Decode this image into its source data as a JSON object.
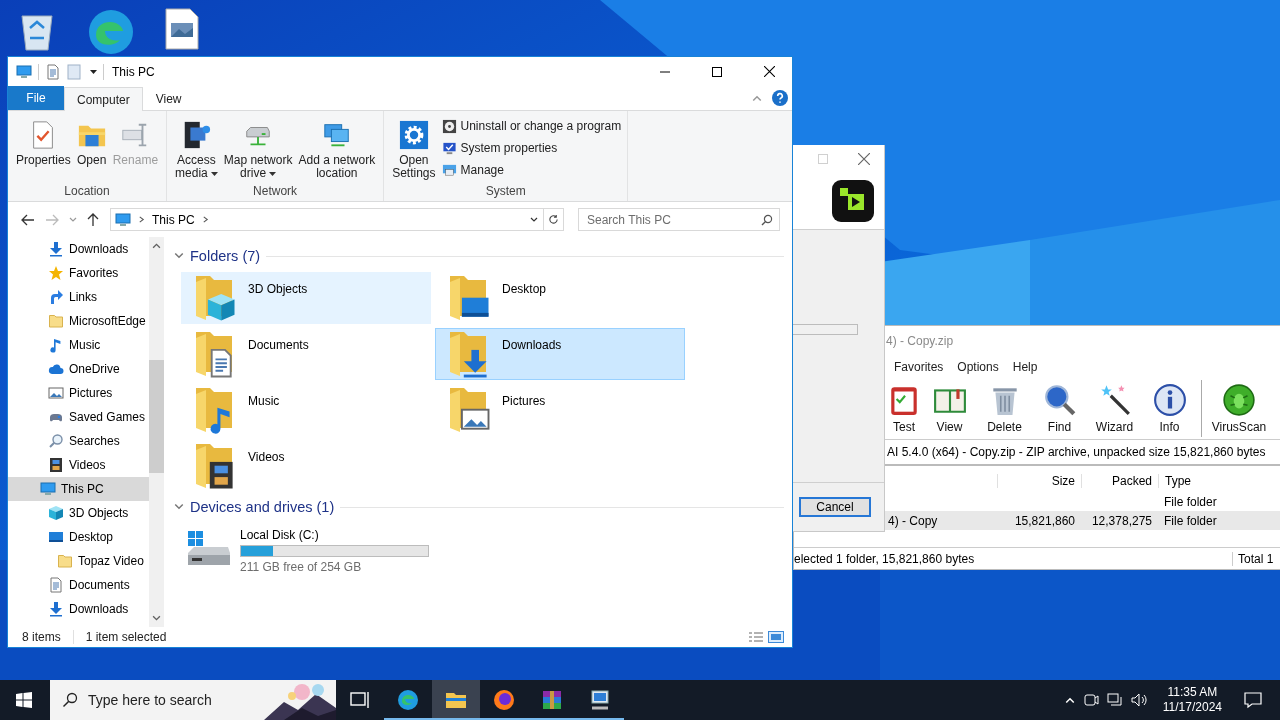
{
  "explorer": {
    "title": "This PC",
    "tabs": [
      {
        "label": "File",
        "kind": "menu",
        "selected": false
      },
      {
        "label": "Computer",
        "kind": "tab",
        "selected": true
      },
      {
        "label": "View",
        "kind": "tab",
        "selected": false
      }
    ],
    "ribbon": [
      {
        "label": "Location",
        "buttons": [
          {
            "label": "Properties",
            "kind": "properties",
            "disabled": false,
            "dropdown": false
          },
          {
            "label": "Open",
            "kind": "open",
            "disabled": false,
            "dropdown": false
          },
          {
            "label": "Rename",
            "kind": "rename",
            "disabled": true,
            "dropdown": false
          }
        ]
      },
      {
        "label": "Network",
        "buttons": [
          {
            "label": "Access\nmedia",
            "kind": "media",
            "disabled": false,
            "dropdown": true
          },
          {
            "label": "Map network\ndrive",
            "kind": "drive",
            "disabled": false,
            "dropdown": true
          },
          {
            "label": "Add a network\nlocation",
            "kind": "netloc",
            "disabled": false,
            "dropdown": false
          }
        ]
      },
      {
        "label": "System",
        "buttons": [
          {
            "label": "Open\nSettings",
            "kind": "settings",
            "disabled": false,
            "dropdown": false
          }
        ],
        "links": [
          {
            "label": "Uninstall or change a program",
            "kind": "uninstall"
          },
          {
            "label": "System properties",
            "kind": "system"
          },
          {
            "label": "Manage",
            "kind": "manage"
          }
        ]
      }
    ],
    "address": {
      "path": [
        "This PC"
      ],
      "search_placeholder": "Search This PC"
    },
    "nav": [
      {
        "label": "Downloads",
        "kind": "download",
        "selected": false
      },
      {
        "label": "Favorites",
        "kind": "star",
        "selected": false
      },
      {
        "label": "Links",
        "kind": "link",
        "selected": false
      },
      {
        "label": "MicrosoftEdge",
        "kind": "folder",
        "selected": false
      },
      {
        "label": "Music",
        "kind": "music",
        "selected": false
      },
      {
        "label": "OneDrive",
        "kind": "cloud",
        "selected": false
      },
      {
        "label": "Pictures",
        "kind": "picture",
        "selected": false
      },
      {
        "label": "Saved Games",
        "kind": "game",
        "selected": false
      },
      {
        "label": "Searches",
        "kind": "search",
        "selected": false
      },
      {
        "label": "Videos",
        "kind": "video",
        "selected": false
      },
      {
        "label": "This PC",
        "kind": "pc",
        "selected": true,
        "children": [
          {
            "label": "3D Objects",
            "kind": "cube",
            "selected": false
          },
          {
            "label": "Desktop",
            "kind": "desktop",
            "selected": false,
            "children": [
              {
                "label": "Topaz Video",
                "kind": "folder",
                "selected": false
              }
            ]
          },
          {
            "label": "Documents",
            "kind": "document",
            "selected": false
          },
          {
            "label": "Downloads",
            "kind": "download",
            "selected": false
          }
        ]
      }
    ],
    "sections": [
      {
        "title": "Folders (7)",
        "kind": "folders",
        "items": [
          {
            "name": "3D Objects",
            "kind": "cube",
            "selected": false,
            "hot": true
          },
          {
            "name": "Desktop",
            "kind": "desktop",
            "selected": false,
            "hot": false
          },
          {
            "name": "Documents",
            "kind": "document",
            "selected": false,
            "hot": false
          },
          {
            "name": "Downloads",
            "kind": "download",
            "selected": true,
            "hot": false
          },
          {
            "name": "Music",
            "kind": "music",
            "selected": false,
            "hot": false
          },
          {
            "name": "Pictures",
            "kind": "picture",
            "selected": false,
            "hot": false
          },
          {
            "name": "Videos",
            "kind": "video",
            "selected": false,
            "hot": false
          }
        ]
      },
      {
        "title": "Devices and drives (1)",
        "kind": "drives",
        "items": [
          {
            "name": "Local Disk (C:)",
            "level": 0.17,
            "free": "211 GB free of 254 GB",
            "selected": false,
            "hot": false
          }
        ]
      }
    ],
    "status": [
      "8 items",
      "1 item selected"
    ]
  },
  "dialog": {
    "cancel": "Cancel"
  },
  "archiver": {
    "title": "4) - Copy.zip",
    "menu": [
      "Favorites",
      "Options",
      "Help"
    ],
    "tools": [
      {
        "label": "Test",
        "kind": "test"
      },
      {
        "label": "View",
        "kind": "book"
      },
      {
        "label": "Delete",
        "kind": "trash"
      },
      {
        "label": "Find",
        "kind": "find"
      },
      {
        "label": "Wizard",
        "kind": "wand"
      },
      {
        "label": "Info",
        "kind": "info"
      },
      {
        "label": "VirusScan",
        "kind": "bug"
      }
    ],
    "address": "AI 5.4.0 (x64) - Copy.zip - ZIP archive, unpacked size 15,821,860 bytes",
    "columns": [
      "Size",
      "Packed",
      "Type"
    ],
    "rows": [
      {
        "type": "File folder",
        "selected": false
      },
      {
        "name": "4) - Copy",
        "size": "15,821,860",
        "packed": "12,378,275",
        "type": "File folder",
        "selected": true
      }
    ],
    "status": [
      "elected 1 folder, 15,821,860 bytes",
      "Total 1"
    ]
  },
  "taskbar": {
    "search_placeholder": "Type here to search",
    "apps": [
      {
        "kind": "taskview",
        "running": false,
        "selected": false
      },
      {
        "kind": "edge",
        "running": true,
        "selected": false
      },
      {
        "kind": "explorer",
        "running": true,
        "selected": true
      },
      {
        "kind": "firefox",
        "running": true,
        "selected": false
      },
      {
        "kind": "archive",
        "running": true,
        "selected": false
      },
      {
        "kind": "installer",
        "running": true,
        "selected": false
      }
    ],
    "time": "11:35 AM",
    "date": "11/17/2024"
  }
}
